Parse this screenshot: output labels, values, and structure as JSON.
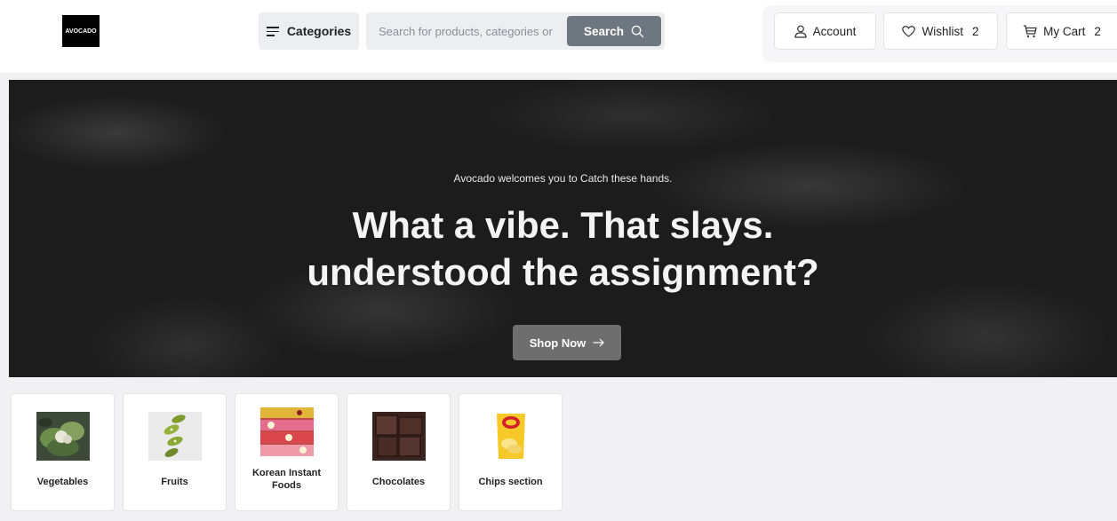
{
  "header": {
    "logo_text": "AVOCADO",
    "categories_label": "Categories",
    "search": {
      "placeholder": "Search for products, categories or",
      "value": "",
      "button_label": "Search"
    },
    "account_label": "Account",
    "wishlist_label": "Wishlist",
    "wishlist_count": "2",
    "cart_label": "My Cart",
    "cart_count": "2"
  },
  "hero": {
    "subtitle": "Avocado welcomes you to Catch these hands.",
    "title_line1": "What a vibe. That slays.",
    "title_line2": "understood the assignment?",
    "cta_label": "Shop Now"
  },
  "categories": [
    {
      "label": "Vegetables",
      "icon": "vegetables-image"
    },
    {
      "label": "Fruits",
      "icon": "kiwi-image"
    },
    {
      "label": "Korean Instant Foods",
      "icon": "instant-noodles-image"
    },
    {
      "label": "Chocolates",
      "icon": "chocolate-image"
    },
    {
      "label": "Chips section",
      "icon": "lays-chips-image"
    }
  ],
  "colors": {
    "hero_bg": "#1c1c1c",
    "button_gray": "#6e7780",
    "page_bg": "#f1f1f4"
  }
}
